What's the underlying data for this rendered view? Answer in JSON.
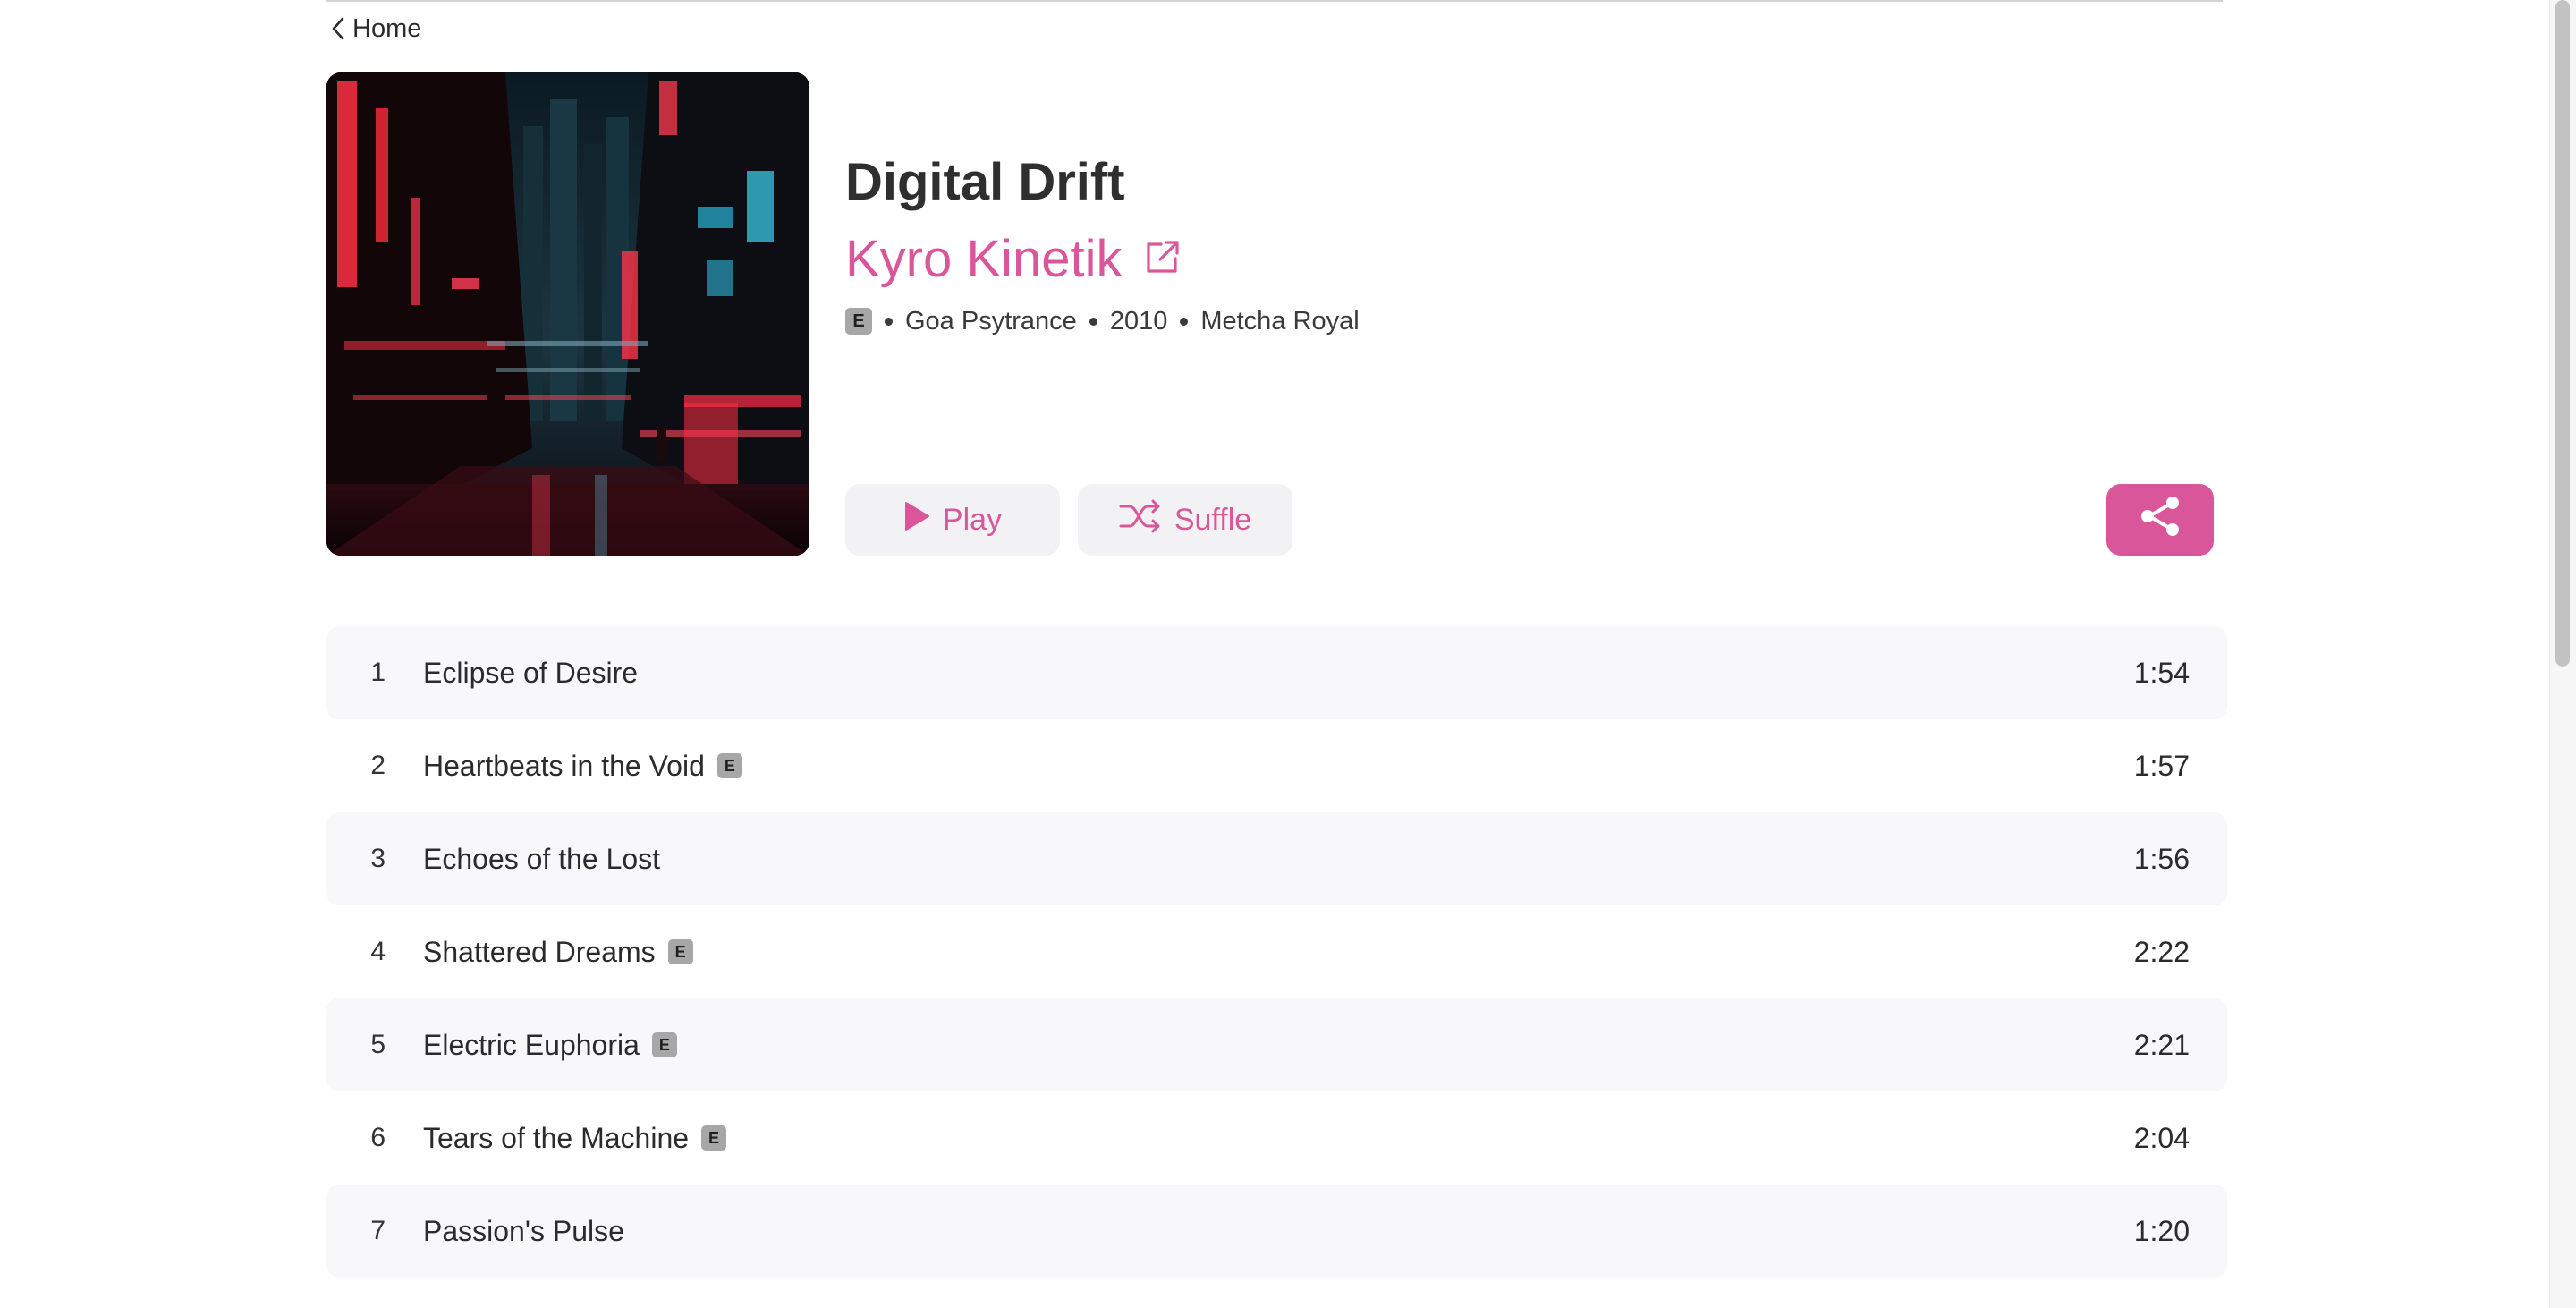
{
  "nav": {
    "back_label": "Home"
  },
  "album": {
    "title": "Digital Drift",
    "artist": "Kyro Kinetik",
    "explicit_label": "E",
    "genre": "Goa Psytrance",
    "year": "2010",
    "label": "Metcha Royal"
  },
  "actions": {
    "play_label": "Play",
    "shuffle_label": "Suffle"
  },
  "tracks": [
    {
      "num": "1",
      "title": "Eclipse of Desire",
      "explicit": false,
      "duration": "1:54"
    },
    {
      "num": "2",
      "title": "Heartbeats in the Void",
      "explicit": true,
      "duration": "1:57"
    },
    {
      "num": "3",
      "title": "Echoes of the Lost",
      "explicit": false,
      "duration": "1:56"
    },
    {
      "num": "4",
      "title": "Shattered Dreams",
      "explicit": true,
      "duration": "2:22"
    },
    {
      "num": "5",
      "title": "Electric Euphoria",
      "explicit": true,
      "duration": "2:21"
    },
    {
      "num": "6",
      "title": "Tears of the Machine",
      "explicit": true,
      "duration": "2:04"
    },
    {
      "num": "7",
      "title": "Passion's Pulse",
      "explicit": false,
      "duration": "1:20"
    }
  ],
  "colors": {
    "accent": "#d9569a",
    "button_bg": "#f2f2f4",
    "row_shade": "#f8f8fa",
    "explicit_bg": "#a7a7a7"
  },
  "icons": {
    "back": "chevron-left-icon",
    "artist_link": "external-link-icon",
    "play": "play-icon",
    "shuffle": "shuffle-icon",
    "share": "share-icon"
  }
}
